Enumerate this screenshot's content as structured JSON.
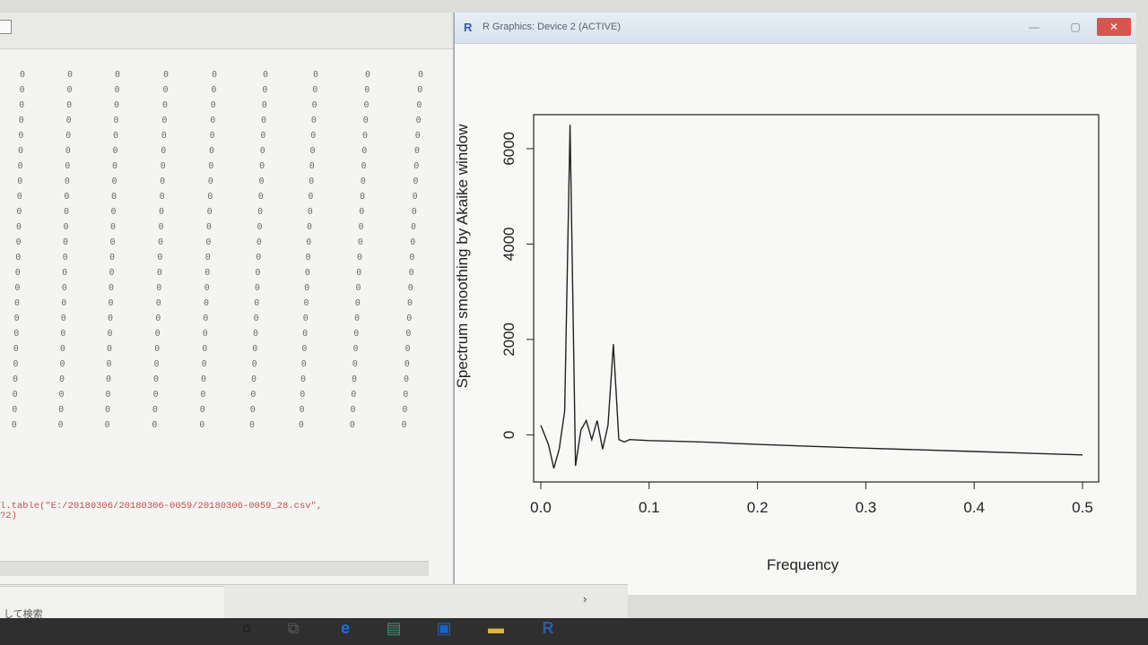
{
  "console": {
    "grid_glyph": "0",
    "command_line1": "l.table(\"E:/20180306/20180306-0059/20180306-0059_28.csv\",",
    "command_line2": "?2)"
  },
  "graphics_window": {
    "title": "R Graphics: Device 2 (ACTIVE)",
    "r_icon": "R",
    "min_glyph": "—",
    "max_glyph": "▢",
    "close_glyph": "✕"
  },
  "chart_data": {
    "type": "line",
    "xlabel": "Frequency",
    "ylabel": "Spectrum smoothing by  Akaike window",
    "xlim": [
      0.0,
      0.5
    ],
    "ylim": [
      -800,
      6600
    ],
    "x_ticks": [
      "0.0",
      "0.1",
      "0.2",
      "0.3",
      "0.4",
      "0.5"
    ],
    "y_ticks": [
      "0",
      "2000",
      "4000",
      "6000"
    ],
    "x": [
      0.0,
      0.007,
      0.012,
      0.017,
      0.022,
      0.027,
      0.032,
      0.037,
      0.042,
      0.047,
      0.052,
      0.057,
      0.062,
      0.067,
      0.072,
      0.077,
      0.082,
      0.1,
      0.15,
      0.2,
      0.3,
      0.4,
      0.5
    ],
    "y": [
      200,
      -200,
      -700,
      -300,
      500,
      6500,
      -650,
      100,
      300,
      -100,
      300,
      -300,
      200,
      1900,
      -100,
      -150,
      -100,
      -120,
      -150,
      -200,
      -280,
      -350,
      -420
    ],
    "grid": false,
    "color": "#222222"
  },
  "status_strip": {
    "arrow": "›"
  },
  "taskbar": {
    "search_text": "して検索",
    "icons": [
      "cortana-icon",
      "task-view-icon",
      "edge-icon",
      "store-icon",
      "outlook-icon",
      "explorer-icon",
      "r-app-icon"
    ]
  }
}
